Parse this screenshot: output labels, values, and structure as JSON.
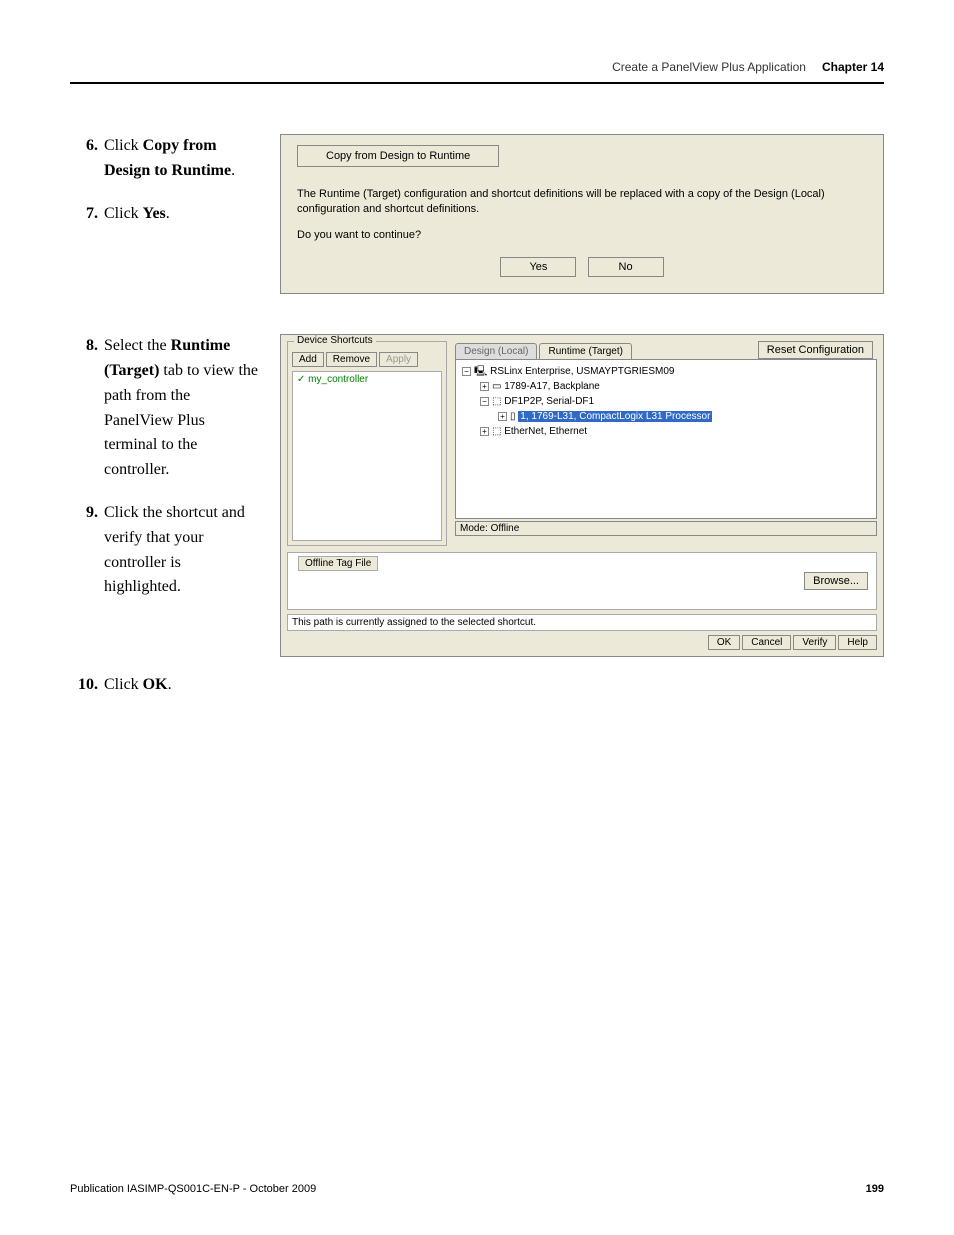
{
  "header": {
    "breadcrumb": "Create a PanelView Plus Application",
    "chapter": "Chapter 14"
  },
  "steps": {
    "s6": {
      "num": "6.",
      "pre": "Click ",
      "bold": "Copy from Design to Runtime",
      "post": "."
    },
    "s7": {
      "num": "7.",
      "pre": "Click ",
      "bold": "Yes",
      "post": "."
    },
    "s8": {
      "num": "8.",
      "pre": "Select the ",
      "bold": "Runtime (Target)",
      "post": " tab to view the path from the PanelView Plus terminal to the controller."
    },
    "s9": {
      "num": "9.",
      "text": "Click the shortcut and verify that your controller is highlighted."
    },
    "s10": {
      "num": "10.",
      "pre": "Click ",
      "bold": "OK",
      "post": "."
    }
  },
  "dialog1": {
    "title": "Copy from Design to Runtime",
    "msg1": "The Runtime (Target) configuration and shortcut definitions will be replaced with a copy of the Design (Local) configuration and shortcut definitions.",
    "msg2": "Do you want to continue?",
    "yes": "Yes",
    "no": "No"
  },
  "dialog2": {
    "shortcuts": {
      "legend": "Device Shortcuts",
      "add": "Add",
      "remove": "Remove",
      "apply": "Apply",
      "item": "my_controller"
    },
    "tabs": {
      "design": "Design (Local)",
      "runtime": "Runtime (Target)"
    },
    "reset": "Reset Configuration",
    "tree": {
      "root": "RSLinx Enterprise, USMAYPTGRIESM09",
      "n1": "1789-A17, Backplane",
      "n2": "DF1P2P, Serial-DF1",
      "n3": "1, 1769-L31, CompactLogix L31 Processor",
      "n4": "EtherNet, Ethernet"
    },
    "mode": "Mode: Offline",
    "tagfile": "Offline Tag File",
    "browse": "Browse...",
    "pathmsg": "This path is currently assigned to the selected shortcut.",
    "buttons": {
      "ok": "OK",
      "cancel": "Cancel",
      "verify": "Verify",
      "help": "Help"
    }
  },
  "footer": {
    "pub": "Publication IASIMP-QS001C-EN-P - October 2009",
    "page": "199"
  }
}
